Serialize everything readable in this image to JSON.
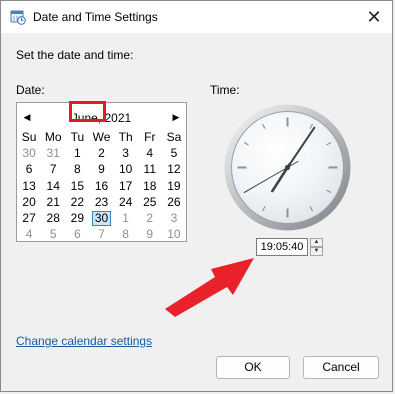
{
  "window": {
    "title": "Date and Time Settings",
    "close_icon": "close-icon"
  },
  "instruction": "Set the date and time:",
  "date_label": "Date:",
  "time_label": "Time:",
  "calendar": {
    "month": "June, 2021",
    "weekdays": [
      "Su",
      "Mo",
      "Tu",
      "We",
      "Th",
      "Fr",
      "Sa"
    ],
    "weeks": [
      [
        {
          "d": "30",
          "o": true
        },
        {
          "d": "31",
          "o": true
        },
        {
          "d": "1"
        },
        {
          "d": "2"
        },
        {
          "d": "3"
        },
        {
          "d": "4"
        },
        {
          "d": "5"
        }
      ],
      [
        {
          "d": "6"
        },
        {
          "d": "7"
        },
        {
          "d": "8"
        },
        {
          "d": "9"
        },
        {
          "d": "10"
        },
        {
          "d": "11"
        },
        {
          "d": "12"
        }
      ],
      [
        {
          "d": "13"
        },
        {
          "d": "14"
        },
        {
          "d": "15"
        },
        {
          "d": "16"
        },
        {
          "d": "17"
        },
        {
          "d": "18"
        },
        {
          "d": "19"
        }
      ],
      [
        {
          "d": "20"
        },
        {
          "d": "21"
        },
        {
          "d": "22"
        },
        {
          "d": "23"
        },
        {
          "d": "24"
        },
        {
          "d": "25"
        },
        {
          "d": "26"
        }
      ],
      [
        {
          "d": "27"
        },
        {
          "d": "28"
        },
        {
          "d": "29"
        },
        {
          "d": "30",
          "sel": true
        },
        {
          "d": "1",
          "o": true
        },
        {
          "d": "2",
          "o": true
        },
        {
          "d": "3",
          "o": true
        }
      ],
      [
        {
          "d": "4",
          "o": true
        },
        {
          "d": "5",
          "o": true
        },
        {
          "d": "6",
          "o": true
        },
        {
          "d": "7",
          "o": true
        },
        {
          "d": "8",
          "o": true
        },
        {
          "d": "9",
          "o": true
        },
        {
          "d": "10",
          "o": true
        }
      ]
    ],
    "selected_date": "30"
  },
  "clock": {
    "hours": 19,
    "minutes": 5,
    "seconds": 40
  },
  "time_field": {
    "value": "19:05:40"
  },
  "link_text": "Change calendar settings",
  "buttons": {
    "ok": "OK",
    "cancel": "Cancel"
  },
  "colors": {
    "highlight": "#d6202a",
    "arrow": "#e8212b",
    "link": "#1a5aa6",
    "selection": "#cde4f7"
  }
}
